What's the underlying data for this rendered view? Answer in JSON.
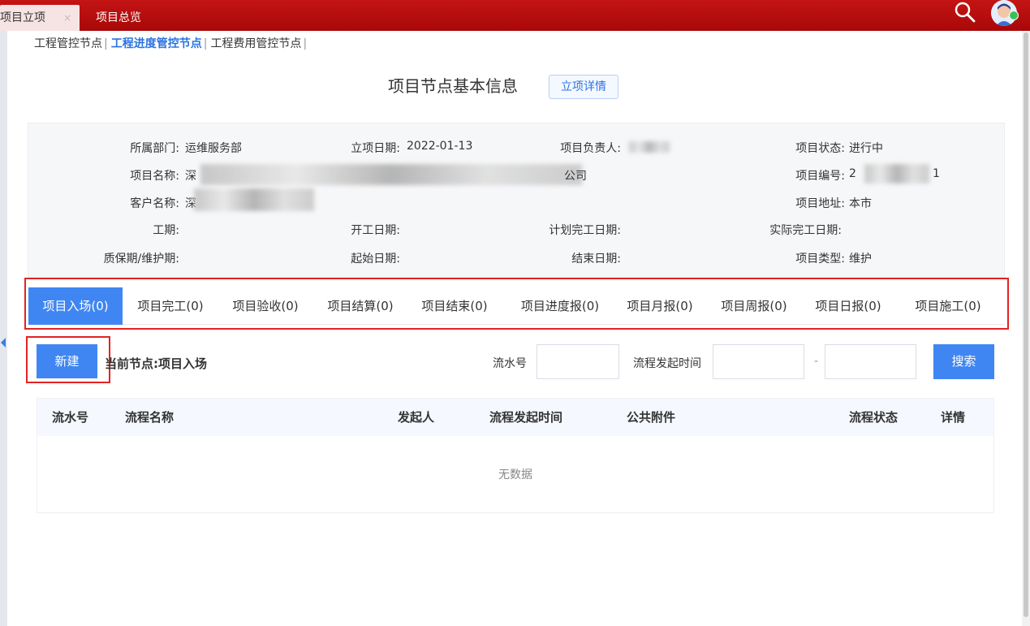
{
  "topbar": {
    "tabs": [
      {
        "label": "项目立项",
        "close": "×"
      },
      {
        "label": "项目总览"
      }
    ],
    "icons": [
      "search-icon",
      "user-avatar"
    ],
    "color": "#b30c0c"
  },
  "subnav": {
    "items": [
      "工程管控节点",
      "工程进度管控节点",
      "工程费用管控节点"
    ],
    "active": "工程进度管控节点",
    "separator": "|"
  },
  "header": {
    "title": "项目节点基本信息",
    "detail_button": "立项详情"
  },
  "info": {
    "dept_label": "所属部门:",
    "dept_value": "运维服务部",
    "date_label": "立项日期:",
    "date_value": "2022-01-13",
    "owner_label": "项目负责人:",
    "status_label": "项目状态:",
    "status_value": "进行中",
    "name_label": "项目名称:",
    "name_value_start": "深",
    "name_value_end": "公司",
    "code_label": "项目编号:",
    "code_value_start": "2",
    "code_value_end": "1",
    "client_label": "客户名称:",
    "client_value_start": "深",
    "address_label": "项目地址:",
    "address_value": "本市",
    "period_label": "工期:",
    "start_label": "开工日期:",
    "plan_end_label": "计划完工日期:",
    "actual_end_label": "实际完工日期:",
    "warranty_label": "质保期/维护期:",
    "begin_label": "起始日期:",
    "end_label": "结束日期:",
    "type_label": "项目类型:",
    "type_value": "维护"
  },
  "tabs": [
    "项目入场(0)",
    "项目完工(0)",
    "项目验收(0)",
    "项目结算(0)",
    "项目结束(0)",
    "项目进度报(0)",
    "项目月报(0)",
    "项目周报(0)",
    "项目日报(0)",
    "项目施工(0)"
  ],
  "actions": {
    "new_button": "新建",
    "current_node": "当前节点:项目入场",
    "serial_label": "流水号",
    "time_label": "流程发起时间",
    "dash": "-",
    "search_button": "搜索"
  },
  "table": {
    "columns": [
      "流水号",
      "流程名称",
      "发起人",
      "流程发起时间",
      "公共附件",
      "流程状态",
      "详情"
    ],
    "empty_text": "无数据"
  },
  "colors": {
    "accent": "#3f86f2",
    "highlight": "#e42222"
  }
}
